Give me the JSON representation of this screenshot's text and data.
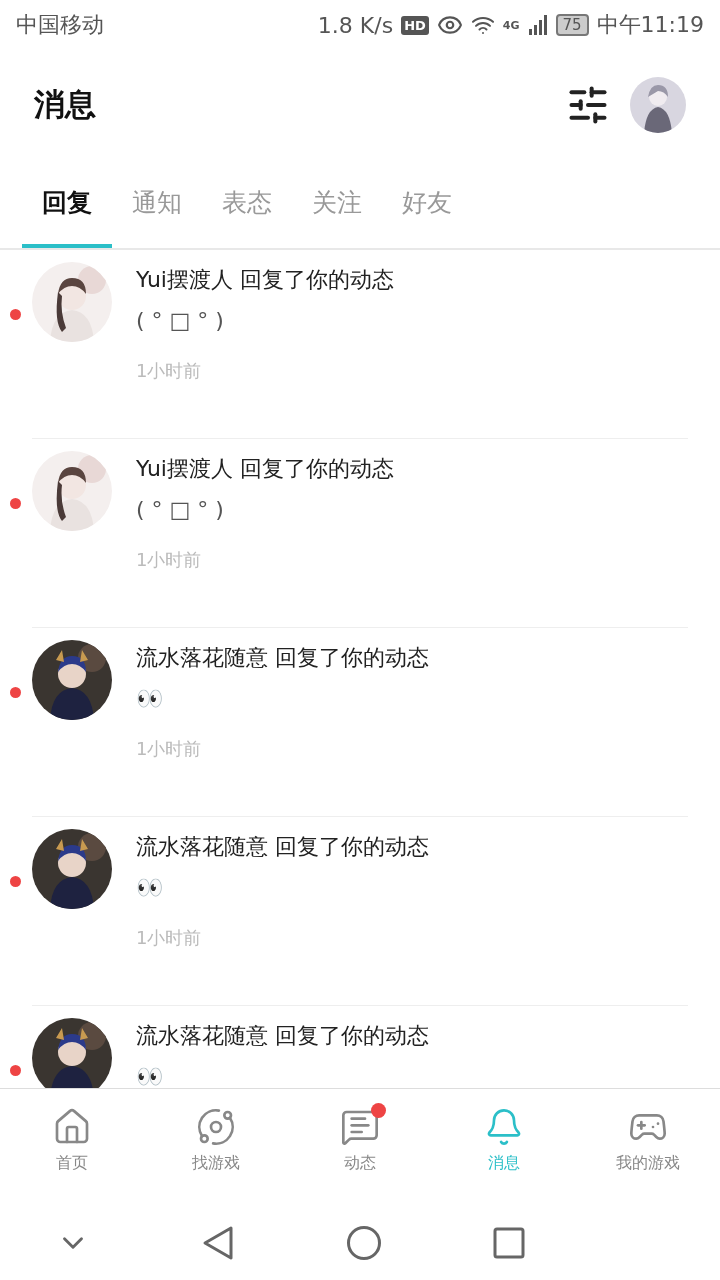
{
  "status_bar": {
    "carrier": "中国移动",
    "speed": "1.8 K/s",
    "hd": "HD",
    "network": "4G",
    "battery": "75",
    "time": "中午11:19"
  },
  "header": {
    "title": "消息"
  },
  "tabs": [
    {
      "label": "回复",
      "selected": true
    },
    {
      "label": "通知",
      "selected": false
    },
    {
      "label": "表态",
      "selected": false
    },
    {
      "label": "关注",
      "selected": false
    },
    {
      "label": "好友",
      "selected": false
    }
  ],
  "messages": [
    {
      "unread": true,
      "title": "Yui摆渡人 回复了你的动态",
      "content": "( ° □ ° )",
      "time": "1小时前"
    },
    {
      "unread": true,
      "title": "Yui摆渡人 回复了你的动态",
      "content": "( ° □ ° )",
      "time": "1小时前"
    },
    {
      "unread": true,
      "title": "流水落花随意 回复了你的动态",
      "content": "👀",
      "time": "1小时前"
    },
    {
      "unread": true,
      "title": "流水落花随意 回复了你的动态",
      "content": "👀",
      "time": "1小时前"
    },
    {
      "unread": true,
      "title": "流水落花随意 回复了你的动态",
      "content": "👀"
    }
  ],
  "bottom_nav": [
    {
      "kind": "home",
      "label": "首页",
      "selected": false,
      "badge": false
    },
    {
      "kind": "planet",
      "label": "找游戏",
      "selected": false,
      "badge": false
    },
    {
      "kind": "feed",
      "label": "动态",
      "selected": false,
      "badge": true
    },
    {
      "kind": "bell",
      "label": "消息",
      "selected": true,
      "badge": false
    },
    {
      "kind": "gamepad",
      "label": "我的游戏",
      "selected": false,
      "badge": false
    }
  ]
}
